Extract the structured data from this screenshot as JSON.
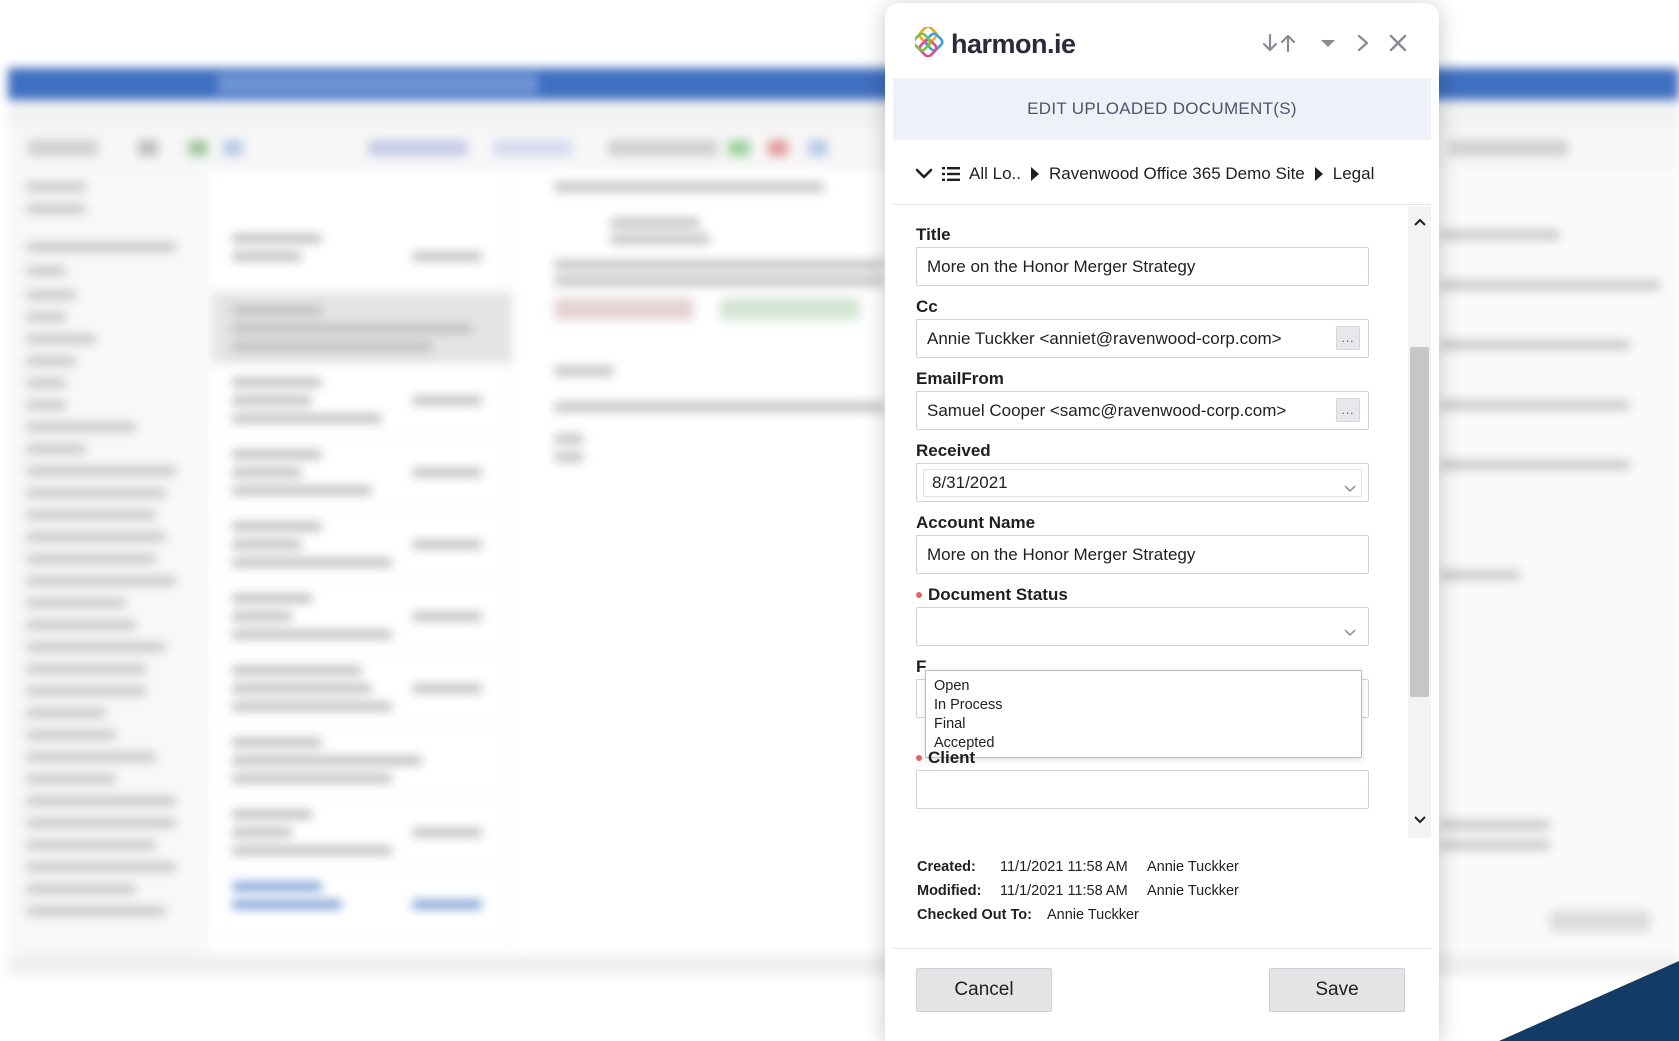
{
  "panel": {
    "brand": "harmon.ie",
    "section_title": "EDIT UPLOADED DOCUMENT(S)",
    "icons": {
      "logo": "harmonie-logo-icon",
      "move_down": "arrow-down-icon",
      "move_up": "arrow-up-icon",
      "menu": "caret-down-icon",
      "forward": "chevron-right-icon",
      "close": "close-icon"
    }
  },
  "breadcrumb": {
    "items": [
      "All Lo..",
      "Ravenwood Office 365 Demo Site",
      "Legal"
    ]
  },
  "form": {
    "title": {
      "label": "Title",
      "value": "More on the Honor Merger Strategy"
    },
    "cc": {
      "label": "Cc",
      "value": "Annie Tuckker <anniet@ravenwood-corp.com>",
      "picker": "..."
    },
    "email_from": {
      "label": "EmailFrom",
      "value": "Samuel Cooper <samc@ravenwood-corp.com>",
      "picker": "..."
    },
    "received": {
      "label": "Received",
      "value": "8/31/2021"
    },
    "account_name": {
      "label": "Account Name",
      "value": "More on the Honor Merger Strategy"
    },
    "document_status": {
      "label": "Document Status",
      "value": "",
      "options": [
        "Open",
        "In Process",
        "Final",
        "Accepted"
      ]
    },
    "hidden_field_initial": "F",
    "client": {
      "label": "Client",
      "value": ""
    }
  },
  "meta": {
    "created_label": "Created:",
    "created_value": "11/1/2021 11:58 AM",
    "created_by": "Annie Tuckker",
    "modified_label": "Modified:",
    "modified_value": "11/1/2021 11:58 AM",
    "modified_by": "Annie Tuckker",
    "checked_out_label": "Checked Out To:",
    "checked_out_value": "Annie Tuckker"
  },
  "buttons": {
    "cancel": "Cancel",
    "save": "Save"
  },
  "colors": {
    "accent_bar": "#eef2f8",
    "required": "#e0675e",
    "outlook_blue": "#3f6fc0"
  }
}
